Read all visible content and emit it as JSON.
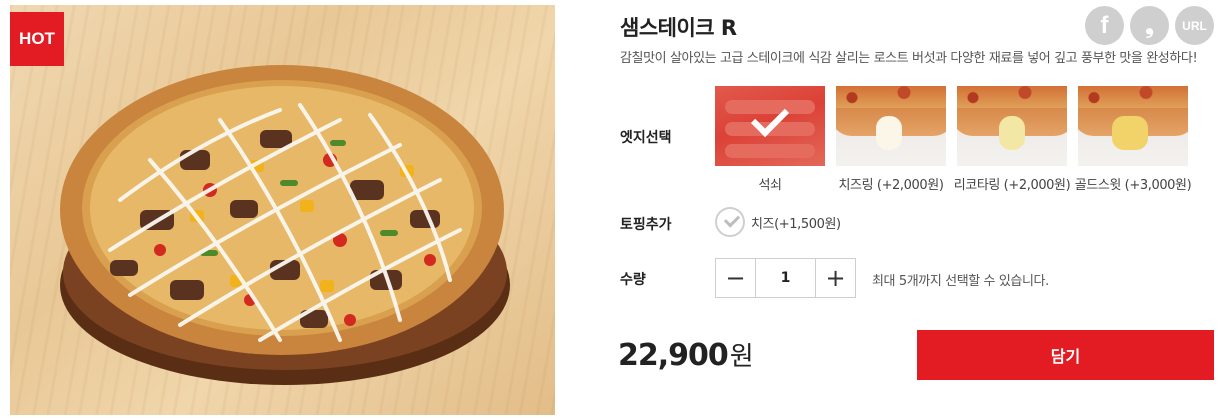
{
  "product": {
    "badge": "HOT",
    "title": "샘스테이크 R",
    "description": "감칠맛이 살아있는 고급 스테이크에 식감 살리는 로스트 버섯과 다양한 재료를 넣어 깊고 풍부한 맛을 완성하다!",
    "price": "22,900",
    "price_unit": "원"
  },
  "share": {
    "facebook_label": "f",
    "kakaostory_label": "❟",
    "url_label": "URL"
  },
  "edge": {
    "label": "엣지선택",
    "options": [
      {
        "label": "석쇠",
        "selected": true
      },
      {
        "label": "치즈링 (+2,000원)",
        "selected": false
      },
      {
        "label": "리코타링 (+2,000원)",
        "selected": false
      },
      {
        "label": "골드스윗 (+3,000원)",
        "selected": false
      }
    ]
  },
  "topping": {
    "label": "토핑추가",
    "option": "치즈(+1,500원)",
    "checked": false
  },
  "quantity": {
    "label": "수량",
    "value": "1",
    "minus": "−",
    "plus": "+",
    "note": "최대 5개까지 선택할 수 있습니다."
  },
  "cart": {
    "button_label": "담기"
  },
  "colors": {
    "accent": "#e31b23",
    "share_icon_bg": "#cfcfcf"
  }
}
